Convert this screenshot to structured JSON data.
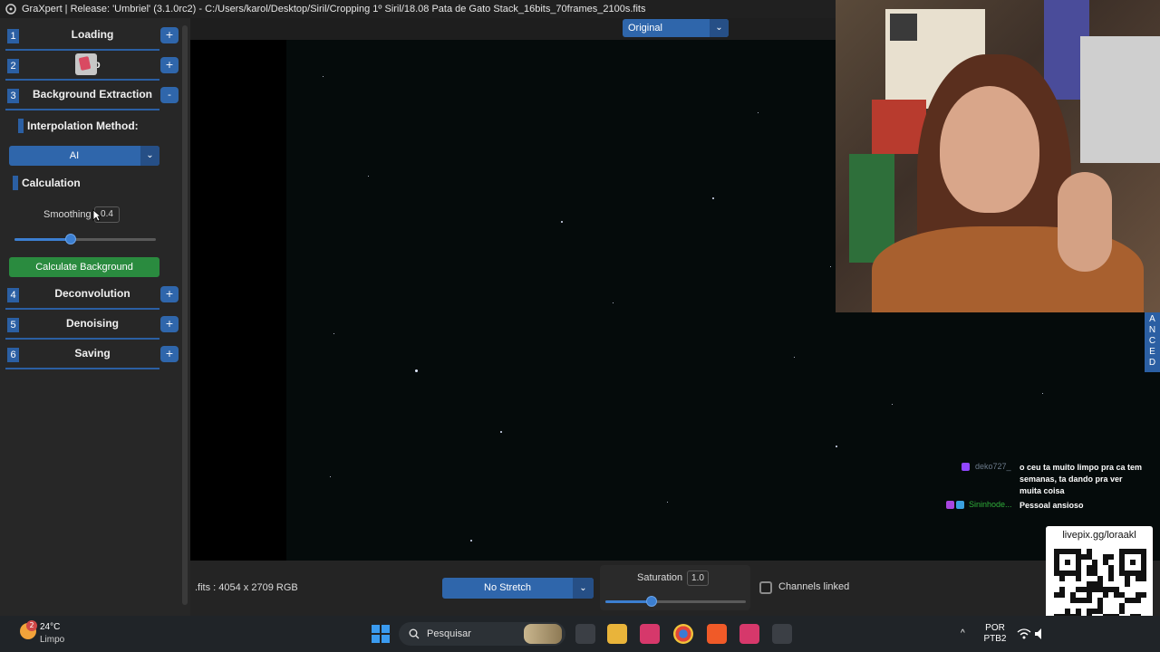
{
  "window": {
    "title": "GraXpert | Release: 'Umbriel' (3.1.0rc2) - C:/Users/karol/Desktop/Siril/Cropping 1º Siril/18.08 Pata de Gato Stack_16bits_70frames_2100s.fits"
  },
  "sidebar": {
    "steps": [
      {
        "num": "1",
        "label": "Loading",
        "toggle": "+"
      },
      {
        "num": "2",
        "label": "op",
        "toggle": "+"
      },
      {
        "num": "3",
        "label": "Background Extraction",
        "toggle": "-"
      },
      {
        "num": "4",
        "label": "Deconvolution",
        "toggle": "+"
      },
      {
        "num": "5",
        "label": "Denoising",
        "toggle": "+"
      },
      {
        "num": "6",
        "label": "Saving",
        "toggle": "+"
      }
    ],
    "interpolation_label": "Interpolation Method:",
    "interpolation_value": "AI",
    "calculation_label": "Calculation",
    "smoothing_label": "Smoothing",
    "smoothing_value": "0.4",
    "smoothing_fraction": 0.4,
    "calculate_button": "Calculate Background"
  },
  "viewer": {
    "view_mode": "Original",
    "file_info": ".fits : 4054 x 2709 RGB",
    "stretch": "No Stretch",
    "saturation_label": "Saturation",
    "saturation_value": "1.0",
    "saturation_fraction": 0.33,
    "channels_linked_label": "Channels linked",
    "channels_linked": false
  },
  "side_tab": {
    "letters": [
      "A",
      "N",
      "C",
      "E",
      "D"
    ]
  },
  "chat": [
    {
      "user": "deko727_",
      "message": "o ceu ta muito limpo pra ca tem semanas, ta dando pra ver muita coisa"
    },
    {
      "user": "Sininhode...",
      "message": "Pessoal ansioso"
    }
  ],
  "qr": {
    "title": "livepix.gg/loraakl"
  },
  "taskbar": {
    "weather_badge": "2",
    "temperature": "24°C",
    "condition": "Limpo",
    "search_placeholder": "Pesquisar",
    "lang": "POR",
    "layout": "PTB2"
  },
  "colors": {
    "accent": "#2f66ab",
    "button_green": "#2a8b3f",
    "sidebar_bg": "#272727"
  }
}
